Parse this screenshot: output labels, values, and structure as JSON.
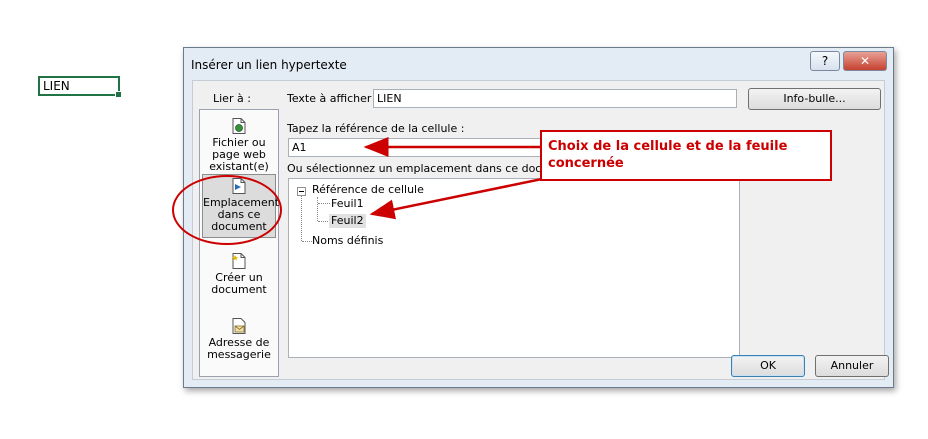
{
  "spreadsheet": {
    "cell_value": "LIEN"
  },
  "dialog": {
    "title": "Insérer un lien hypertexte",
    "help_label": "?",
    "close_label": "✕",
    "link_to_label": "Lier à :",
    "sidebar_items": [
      {
        "label_lines": [
          "Fichier ou",
          "page web",
          "existant(e)"
        ],
        "icon": "web-page-icon",
        "selected": false
      },
      {
        "label_lines": [
          "Emplacement",
          "dans ce",
          "document"
        ],
        "icon": "place-in-document-icon",
        "selected": true
      },
      {
        "label_lines": [
          "Créer un",
          "document"
        ],
        "icon": "new-document-icon",
        "selected": false
      },
      {
        "label_lines": [
          "Adresse de",
          "messagerie"
        ],
        "icon": "email-address-icon",
        "selected": false
      }
    ],
    "display_text_label": "Texte à afficher :",
    "display_text_value": "LIEN",
    "screentip_label": "Info-bulle...",
    "cell_ref_label": "Tapez la référence de la cellule :",
    "cell_ref_value": "A1",
    "select_place_label": "Ou sélectionnez un emplacement dans ce docum",
    "tree": {
      "root_cell_ref": "Référence de cellule",
      "sheets": [
        "Feuil1",
        "Feuil2"
      ],
      "defined_names": "Noms définis"
    },
    "ok_label": "OK",
    "cancel_label": "Annuler"
  },
  "annotation": {
    "callout_text": "Choix de la cellule et de la feuile concernée",
    "color": "#cc0000"
  }
}
